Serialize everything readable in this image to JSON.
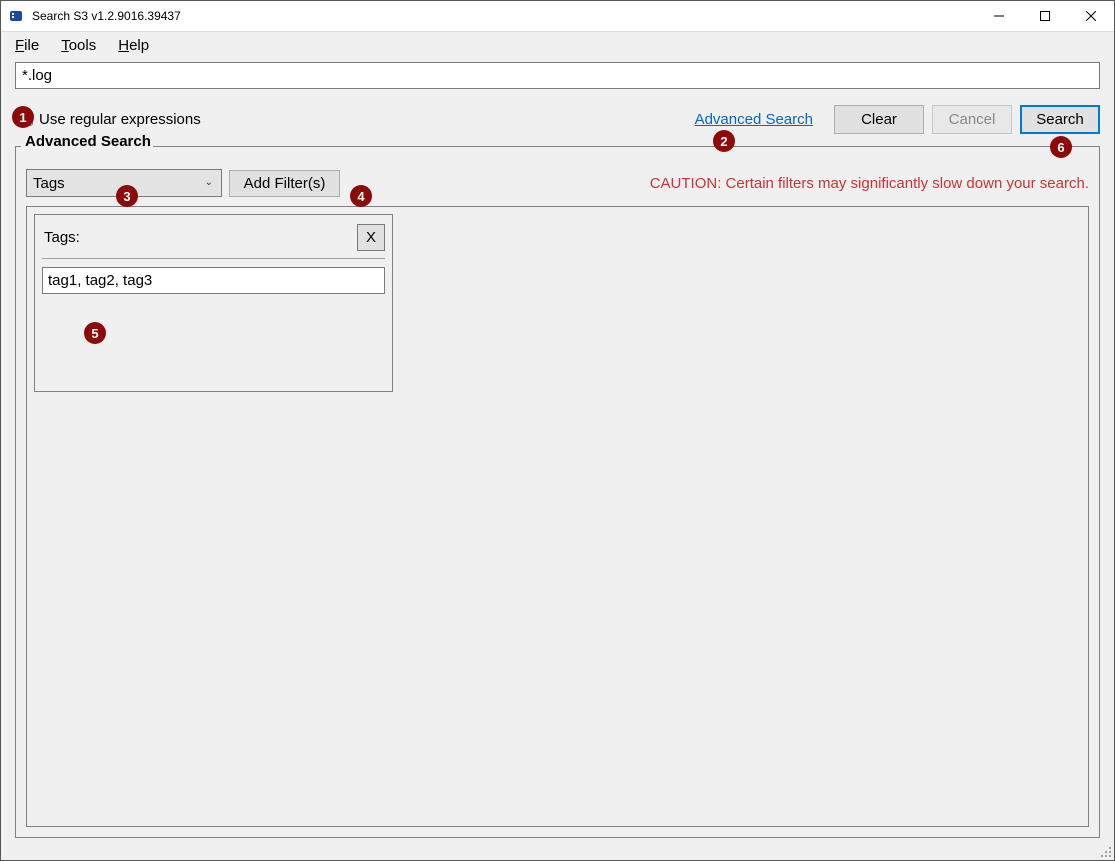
{
  "window": {
    "title": "Search S3 v1.2.9016.39437"
  },
  "menu": {
    "file": "File",
    "tools": "Tools",
    "help": "Help"
  },
  "search": {
    "query": "*.log",
    "regex_label": "Use regular expressions",
    "advanced_link": "Advanced Search",
    "clear": "Clear",
    "cancel": "Cancel",
    "search": "Search"
  },
  "advanced": {
    "title": "Advanced Search",
    "filter_select": "Tags",
    "add_filter": "Add Filter(s)",
    "caution": "CAUTION: Certain filters may significantly slow down your search."
  },
  "filter_card": {
    "title": "Tags:",
    "close": "X",
    "value": "tag1, tag2, tag3"
  },
  "annotations": {
    "1": "1",
    "2": "2",
    "3": "3",
    "4": "4",
    "5": "5",
    "6": "6"
  }
}
